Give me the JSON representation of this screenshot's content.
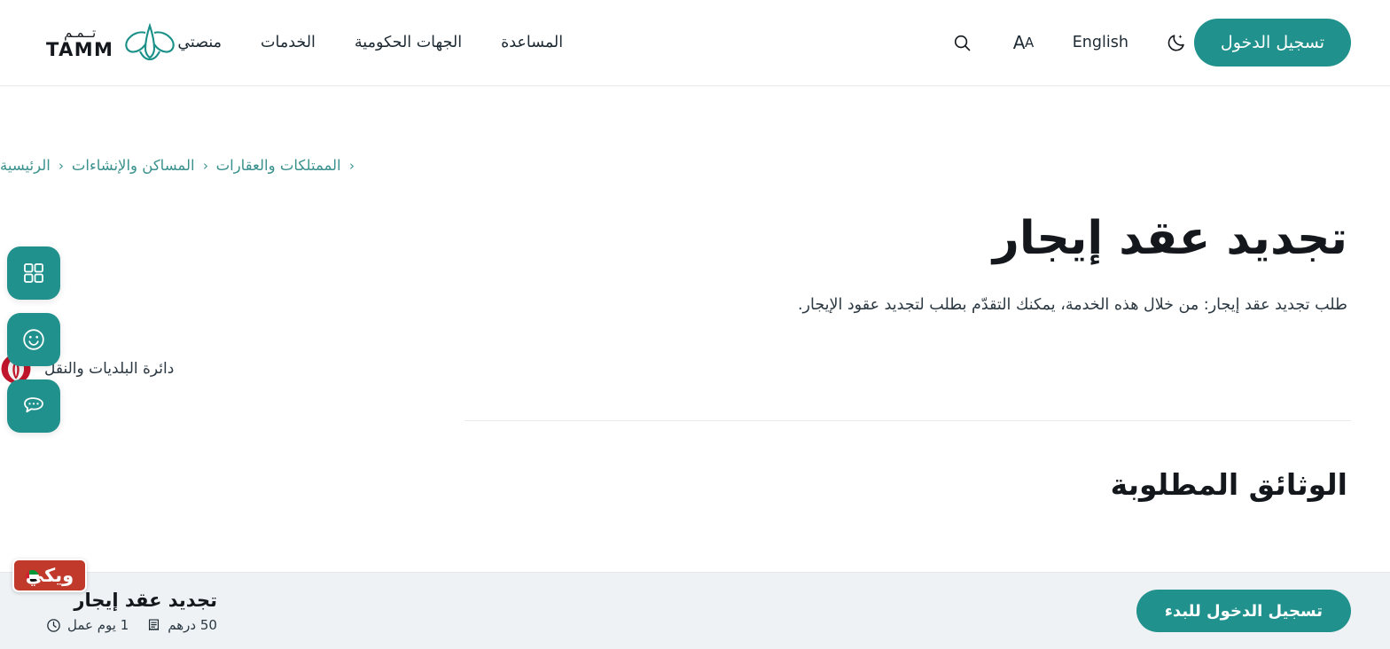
{
  "brand": {
    "logo_ar": "تــمـم",
    "logo_en": "TAMM",
    "accent_color": "#20918C",
    "logo_mark_name": "tamm-falcon-logo"
  },
  "header": {
    "nav": [
      {
        "label": "منصتي",
        "name": "nav-my-platform"
      },
      {
        "label": "الخدمات",
        "name": "nav-services"
      },
      {
        "label": "الجهات الحكومية",
        "name": "nav-government-entities"
      },
      {
        "label": "المساعدة",
        "name": "nav-help"
      }
    ],
    "utils": {
      "search_icon": "search-icon",
      "font_size_label": "AA",
      "language_label": "English",
      "theme_icon": "moon-dark-mode-icon"
    },
    "login_label": "تسجيل الدخول"
  },
  "breadcrumb": [
    {
      "label": "الرئيسية",
      "name": "breadcrumb-home"
    },
    {
      "label": "المساكن والإنشاءات",
      "name": "breadcrumb-housing-construction"
    },
    {
      "label": "الممتلكات والعقارات",
      "name": "breadcrumb-property-real-estate"
    }
  ],
  "page": {
    "title": "تجديد عقد إيجار",
    "description": "طلب تجديد عقد إيجار: من خلال هذه الخدمة، يمكنك التقدّم بطلب لتجديد عقود الإيجار.",
    "department": "دائرة البلديات والنقل",
    "department_emblem": "abu-dhabi-government-emblem",
    "section_heading": "الوثائق المطلوبة"
  },
  "fab_rail": [
    {
      "name": "apps-grid-icon",
      "title": "الخدمات"
    },
    {
      "name": "smiley-feedback-icon",
      "title": "ملاحظات"
    },
    {
      "name": "chat-bubble-icon",
      "title": "الدردشة"
    }
  ],
  "wiki_badge": {
    "label": "ويكي",
    "color": "#C0392B"
  },
  "sticky_bar": {
    "service_title": "تجديد عقد إيجار",
    "duration": "1 يوم عمل",
    "duration_icon": "clock-icon",
    "fee": "50 درهم",
    "fee_icon": "receipt-invoice-icon",
    "cta_label": "تسجيل الدخول للبدء"
  }
}
